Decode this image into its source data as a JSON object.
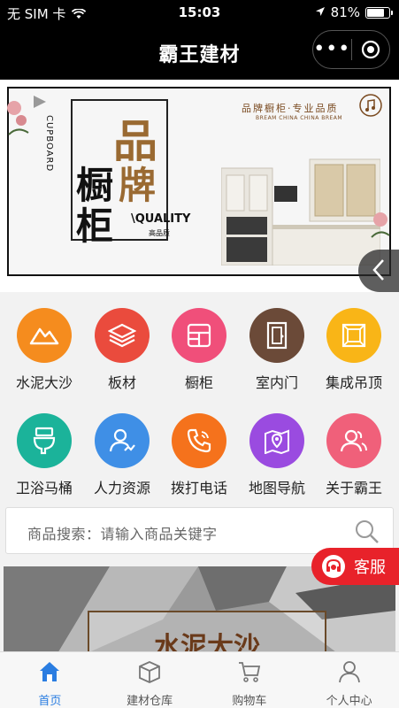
{
  "status": {
    "carrier": "无 SIM 卡",
    "time": "15:03",
    "battery": "81%",
    "battery_level": 0.81
  },
  "nav": {
    "title": "霸王建材"
  },
  "banner": {
    "char1": "品",
    "char2": "橱",
    "char3": "牌",
    "char4": "柜",
    "quality": "\\QUALITY",
    "quality_sub": "高品质",
    "cupboard": "CUPBOARD",
    "tag_cn": "品牌橱柜·专业品质",
    "tag_en": "BREAM CHINA CHINA BREAM",
    "slider_icon": "chevron-left"
  },
  "menu": {
    "items": [
      {
        "label": "水泥大沙",
        "color": "#f58c1e",
        "icon": "mountain-icon"
      },
      {
        "label": "板材",
        "color": "#ea4b3d",
        "icon": "layers-icon"
      },
      {
        "label": "橱柜",
        "color": "#f04f7a",
        "icon": "cabinet-icon"
      },
      {
        "label": "室内门",
        "color": "#6b4a38",
        "icon": "door-icon"
      },
      {
        "label": "集成吊顶",
        "color": "#f9b517",
        "icon": "ceiling-icon"
      },
      {
        "label": "卫浴马桶",
        "color": "#1bb39a",
        "icon": "toilet-icon"
      },
      {
        "label": "人力资源",
        "color": "#3f8fe6",
        "icon": "people-icon"
      },
      {
        "label": "拨打电话",
        "color": "#f5721c",
        "icon": "phone-icon"
      },
      {
        "label": "地图导航",
        "color": "#9a4be0",
        "icon": "map-icon"
      },
      {
        "label": "关于霸王",
        "color": "#f0607a",
        "icon": "user-group-icon"
      }
    ]
  },
  "search": {
    "placeholder": "商品搜索：请输入商品关键字"
  },
  "content": {
    "card_title": "水泥大沙"
  },
  "service": {
    "label": "客服"
  },
  "tabs": [
    {
      "label": "首页",
      "icon": "home-icon",
      "active": true
    },
    {
      "label": "建材仓库",
      "icon": "box-icon",
      "active": false
    },
    {
      "label": "购物车",
      "icon": "cart-icon",
      "active": false
    },
    {
      "label": "个人中心",
      "icon": "person-icon",
      "active": false
    }
  ]
}
